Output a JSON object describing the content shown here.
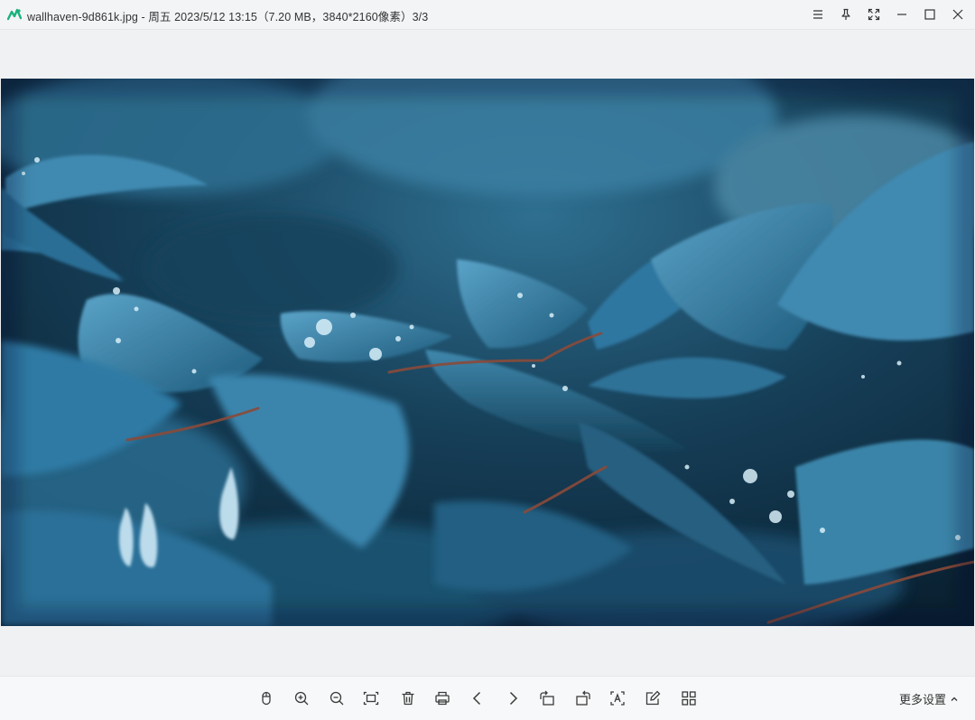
{
  "titlebar": {
    "title": "wallhaven-9d861k.jpg - 周五 2023/5/12 13:15（7.20 MB，3840*2160像素）3/3",
    "controls": [
      "menu-icon",
      "pin-icon",
      "fullscreen-icon",
      "minimize-icon",
      "maximize-icon",
      "close-icon"
    ]
  },
  "viewer": {
    "image_subject": "blue leaves with water droplets"
  },
  "toolbar": {
    "tools": [
      "mouse-icon",
      "zoom-in-icon",
      "zoom-out-icon",
      "fit-screen-icon",
      "delete-icon",
      "print-icon",
      "previous-icon",
      "next-icon",
      "rotate-left-icon",
      "rotate-right-icon",
      "ocr-icon",
      "edit-icon",
      "grid-icon"
    ],
    "more_settings": "更多设置"
  },
  "colors": {
    "titlebar_bg": "#f3f4f6",
    "canvas_bg": "#eff1f3",
    "toolbar_bg": "#f7f8f9",
    "icon_color": "#3a3a3a",
    "logo_green": "#18b27c"
  }
}
